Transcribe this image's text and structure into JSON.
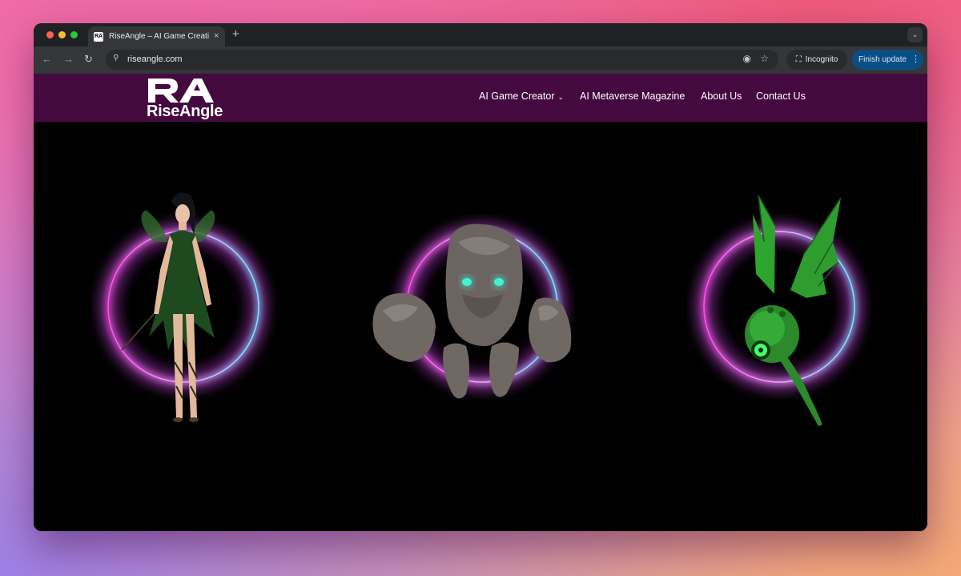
{
  "browser": {
    "tab_title": "RiseAngle – AI Game Creation",
    "tab_favicon_text": "RA",
    "tab_close_glyph": "×",
    "new_tab_glyph": "+",
    "tab_menu_glyph": "⌄",
    "back_glyph": "←",
    "forward_glyph": "→",
    "reload_glyph": "↻",
    "site_info_glyph": "⚲",
    "url": "riseangle.com",
    "eye_glyph": "◉",
    "star_glyph": "☆",
    "incognito_glyph": "⛶",
    "incognito_label": "Incognito",
    "finish_update_label": "Finish update",
    "menu_glyph": "⋮"
  },
  "site": {
    "logo_text": "RiseAngle",
    "logo_mark_text": "RA",
    "nav": [
      {
        "label": "AI Game Creator",
        "chevron": "⌄"
      },
      {
        "label": "AI Metaverse Magazine"
      },
      {
        "label": "About Us"
      },
      {
        "label": "Contact Us"
      }
    ]
  },
  "colors": {
    "header_bg": "#44093f",
    "portal_pink": "#ff4fe6",
    "portal_cyan": "#6fe8ff",
    "dragon_green": "#2ea52e",
    "golem_eye": "#3ef5d0"
  }
}
